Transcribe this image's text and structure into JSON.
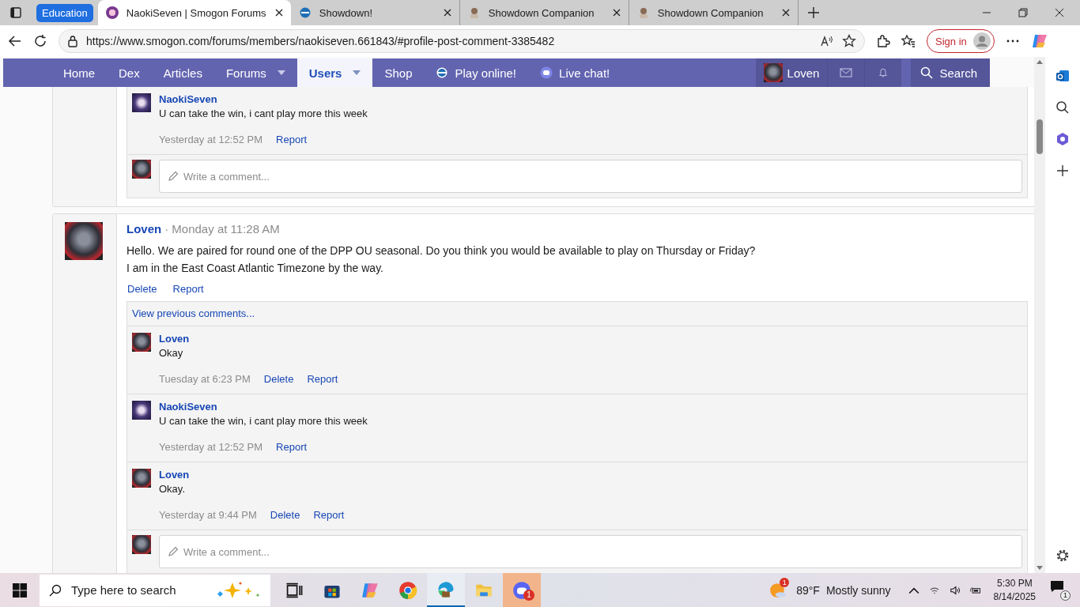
{
  "browser": {
    "tab_group": "Education",
    "tabs": [
      {
        "title": "NaokiSeven | Smogon Forums",
        "selected": true,
        "kind": "forum"
      },
      {
        "title": "Showdown!",
        "selected": false,
        "kind": "battle"
      },
      {
        "title": "Showdown Companion",
        "selected": false,
        "kind": "companion"
      },
      {
        "title": "Showdown Companion",
        "selected": false,
        "kind": "companion"
      }
    ],
    "url": "https://www.smogon.com/forums/members/naokiseven.661843/#profile-post-comment-3385482",
    "sign_in": "Sign in"
  },
  "nav": {
    "items": [
      {
        "label": "Home",
        "selected": false,
        "dropdown": false,
        "kind": "plain"
      },
      {
        "label": "Dex",
        "selected": false,
        "dropdown": false,
        "kind": "plain"
      },
      {
        "label": "Articles",
        "selected": false,
        "dropdown": false,
        "kind": "plain"
      },
      {
        "label": "Forums",
        "selected": false,
        "dropdown": true,
        "kind": "plain"
      },
      {
        "label": "Users",
        "selected": true,
        "dropdown": true,
        "kind": "plain"
      },
      {
        "label": "Shop",
        "selected": false,
        "dropdown": false,
        "kind": "plain"
      },
      {
        "label": "Play online!",
        "selected": false,
        "dropdown": false,
        "kind": "play"
      },
      {
        "label": "Live chat!",
        "selected": false,
        "dropdown": false,
        "kind": "chat"
      }
    ],
    "user": "Loven",
    "search": "Search"
  },
  "posts": [
    {
      "comments": [
        {
          "author": "NaokiSeven",
          "kind": "other",
          "text": "U can take the win, i cant play more this week",
          "time": "Yesterday at 12:52 PM",
          "actions": [
            "Report"
          ]
        }
      ],
      "write_placeholder": "Write a comment..."
    },
    {
      "author": "Loven",
      "time": "· Monday at 11:28 AM",
      "lines": [
        "Hello. We are paired for round one of the DPP OU seasonal. Do you think you would be available to play on Thursday or Friday?",
        "I am in the East Coast Atlantic Timezone by the way."
      ],
      "actions": [
        "Delete",
        "Report"
      ],
      "view_previous": "View previous comments...",
      "comments": [
        {
          "author": "Loven",
          "kind": "own",
          "text": "Okay",
          "time": "Tuesday at 6:23 PM",
          "actions": [
            "Delete",
            "Report"
          ]
        },
        {
          "author": "NaokiSeven",
          "kind": "other",
          "text": "U can take the win, i cant play more this week",
          "time": "Yesterday at 12:52 PM",
          "actions": [
            "Report"
          ]
        },
        {
          "author": "Loven",
          "kind": "own",
          "text": "Okay.",
          "time": "Yesterday at 9:44 PM",
          "actions": [
            "Delete",
            "Report"
          ]
        }
      ],
      "write_placeholder": "Write a comment..."
    }
  ],
  "taskbar": {
    "search": "Type here to search",
    "discord_badge": "1",
    "weather_badge": "1",
    "temperature": "89°F",
    "condition": "Mostly sunny",
    "time": "5:30 PM",
    "date": "8/14/2025",
    "notifications": "1"
  }
}
